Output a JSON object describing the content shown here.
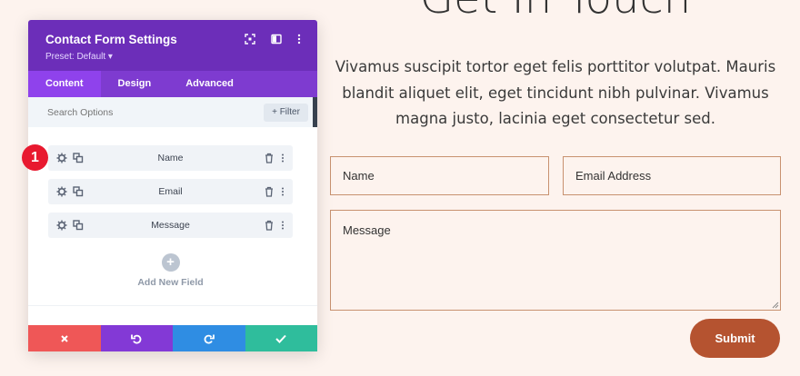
{
  "page": {
    "heading": "Get In Touch",
    "intro": "Vivamus suscipit tortor eget felis porttitor volutpat. Mauris blandit aliquet elit, eget tincidunt nibh pulvinar. Vivamus magna justo, lacinia eget consectetur sed.",
    "form": {
      "name_placeholder": "Name",
      "email_placeholder": "Email Address",
      "message_placeholder": "Message",
      "submit_label": "Submit"
    }
  },
  "panel": {
    "title": "Contact Form Settings",
    "preset": "Preset: Default ▾",
    "tabs": [
      {
        "label": "Content",
        "active": true
      },
      {
        "label": "Design",
        "active": false
      },
      {
        "label": "Advanced",
        "active": false
      }
    ],
    "search_placeholder": "Search Options",
    "filter_label": "+ Filter",
    "fields": [
      {
        "label": "Name"
      },
      {
        "label": "Email"
      },
      {
        "label": "Message"
      }
    ],
    "add_field_label": "Add New Field",
    "add_icon": "+"
  },
  "annotation": {
    "badge": "1"
  },
  "colors": {
    "panel_header": "#6c2eb9",
    "tabs_bg": "#7e3bd0",
    "submit": "#b55330",
    "close": "#ef5757",
    "undo": "#8339d6",
    "redo": "#2f8de3",
    "save": "#2fbd9c",
    "badge": "#e8192f"
  }
}
